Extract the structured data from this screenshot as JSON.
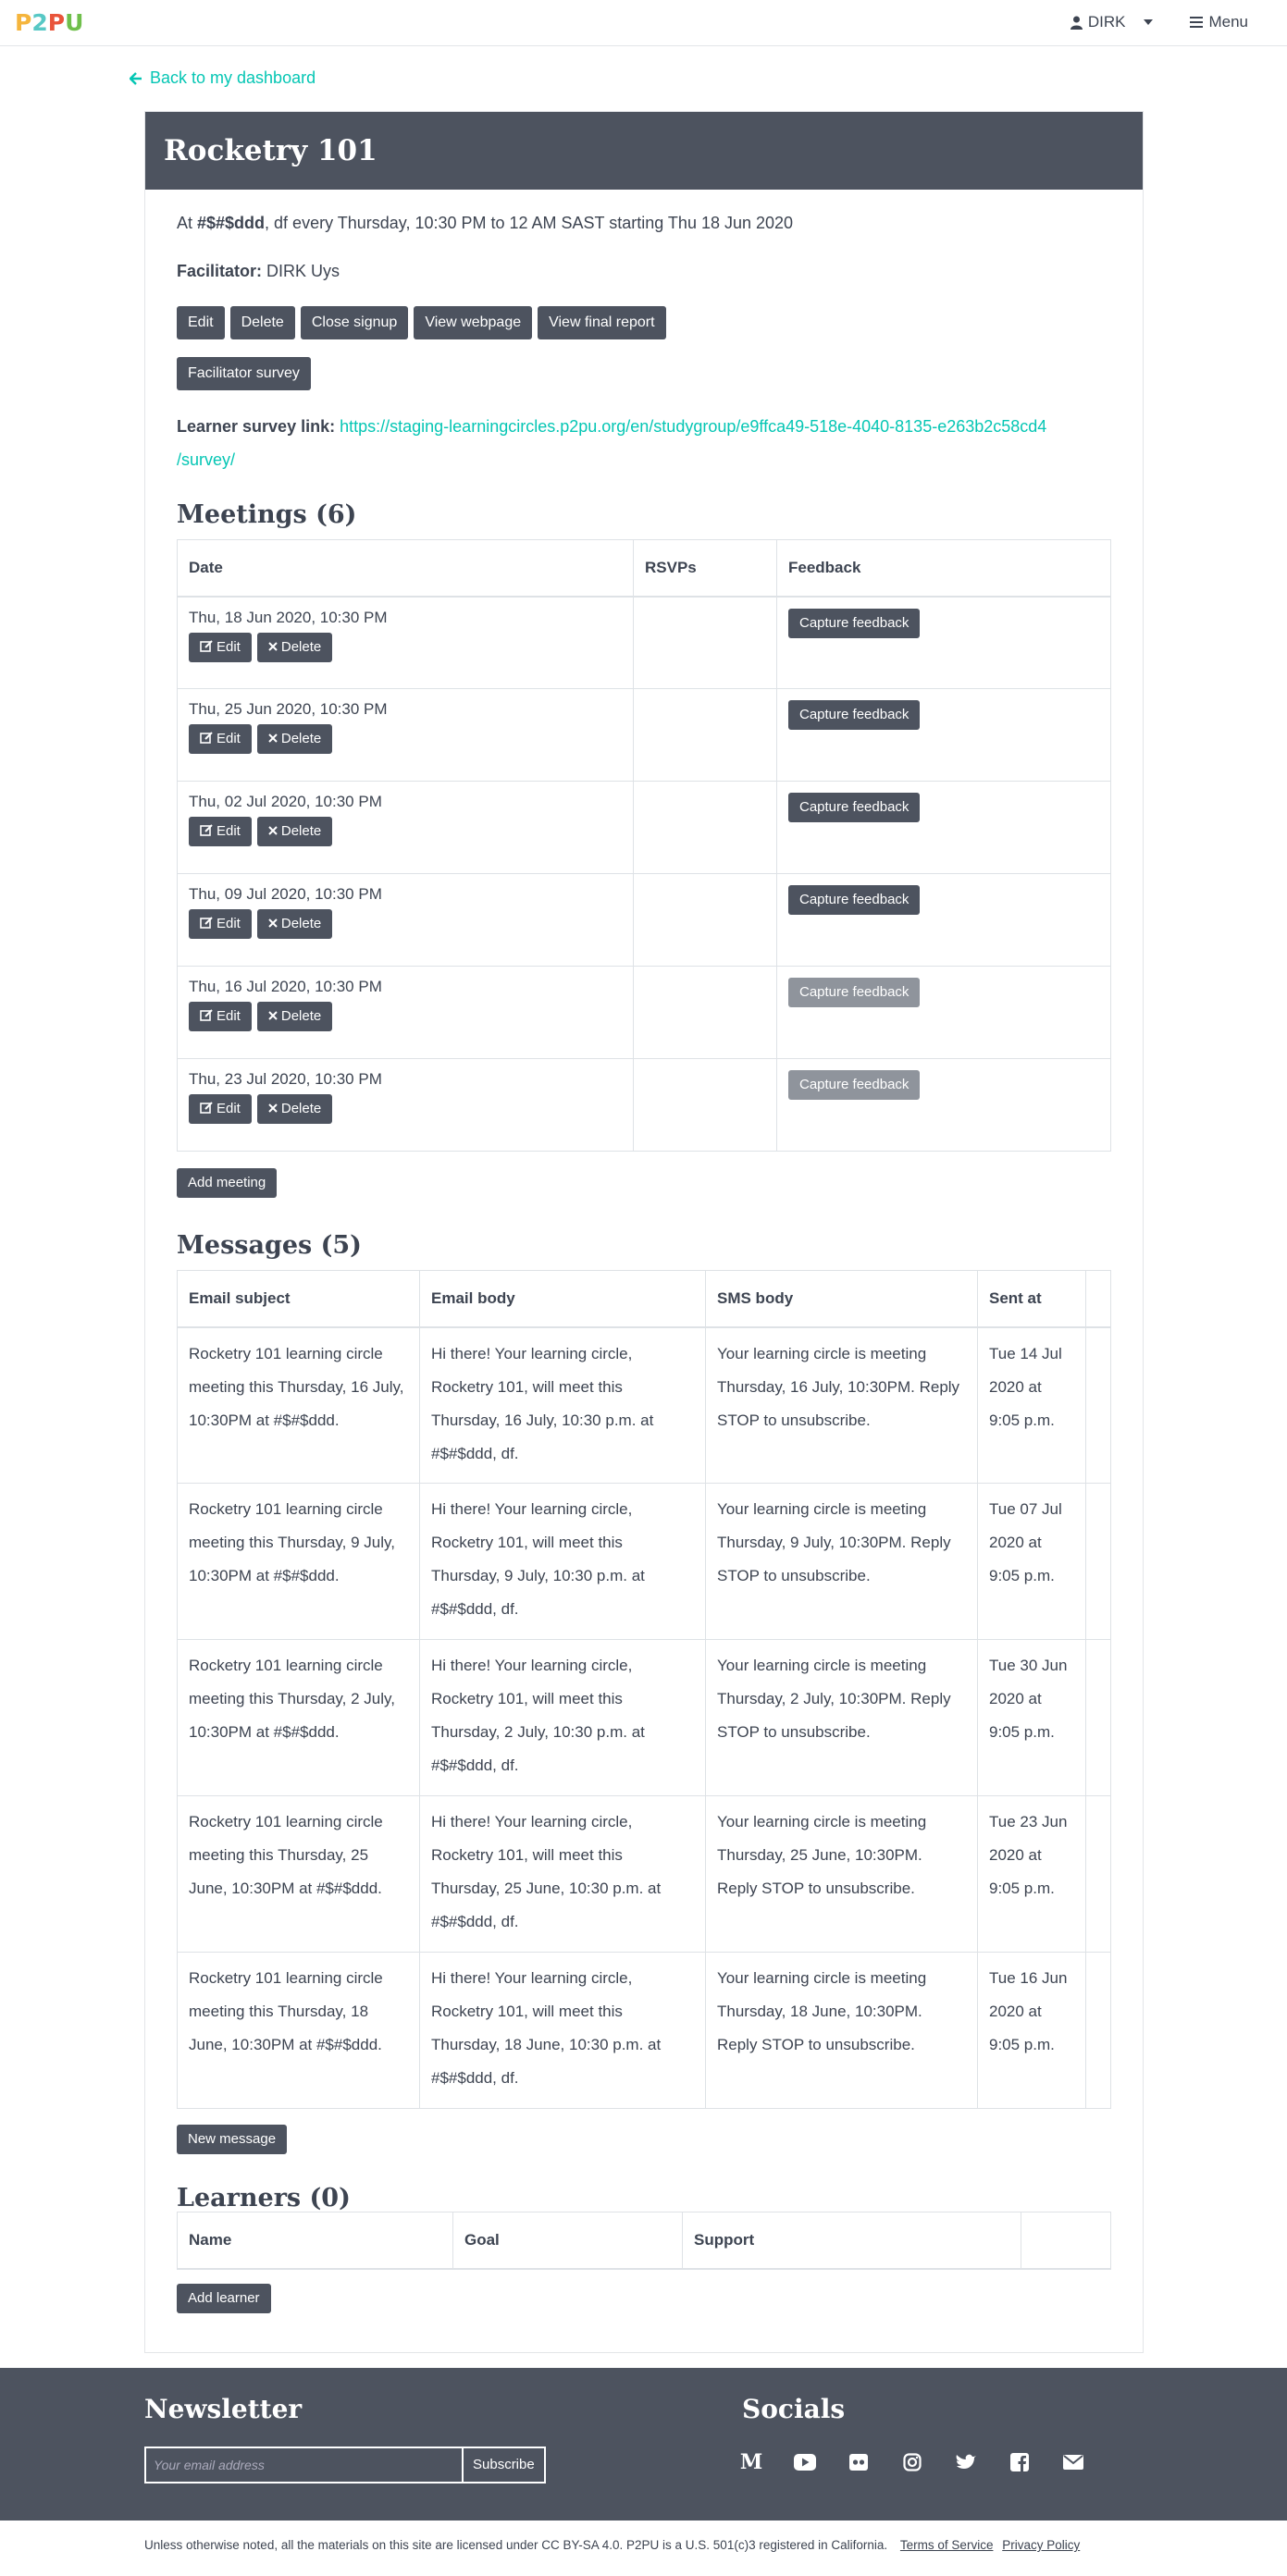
{
  "nav": {
    "logo": [
      "P",
      "2",
      "P",
      "U"
    ],
    "user": "DIRK",
    "menu": "Menu"
  },
  "back_link": "Back to my dashboard",
  "course": {
    "title": "Rocketry 101",
    "schedule_prefix": "At ",
    "venue": "#$#$ddd",
    "schedule_rest": ", df every Thursday, 10:30 PM to 12 AM SAST starting Thu 18 Jun 2020",
    "facilitator_label": "Facilitator:",
    "facilitator": " DIRK Uys"
  },
  "buttons": {
    "edit": "Edit",
    "delete": "Delete",
    "close_signup": "Close signup",
    "view_webpage": "View webpage",
    "view_final_report": "View final report",
    "facilitator_survey": "Facilitator survey"
  },
  "survey": {
    "label": "Learner survey link:",
    "url_line1": "https://staging-learningcircles.p2pu.org/en/studygroup/e9ffca49-518e-4040-8135-e263b2c58cd4",
    "url_line2": "/survey/"
  },
  "meetings": {
    "heading": "Meetings (6)",
    "columns": [
      "Date",
      "RSVPs",
      "Feedback"
    ],
    "edit_label": "Edit",
    "delete_label": "Delete",
    "feedback_label": "Capture feedback",
    "rows": [
      {
        "date": "Thu, 18 Jun 2020, 10:30 PM"
      },
      {
        "date": "Thu, 25 Jun 2020, 10:30 PM"
      },
      {
        "date": "Thu, 02 Jul 2020, 10:30 PM"
      },
      {
        "date": "Thu, 09 Jul 2020, 10:30 PM"
      },
      {
        "date": "Thu, 16 Jul 2020, 10:30 PM"
      },
      {
        "date": "Thu, 23 Jul 2020, 10:30 PM"
      }
    ],
    "add_label": "Add meeting"
  },
  "messages": {
    "heading": "Messages (5)",
    "columns": [
      "Email subject",
      "Email body",
      "SMS body",
      "Sent at"
    ],
    "rows": [
      {
        "subject": "Rocketry 101 learning circle meeting this Thursday, 16 July, 10:30PM at #$#$ddd.",
        "body": "Hi there! Your learning circle, Rocketry 101, will meet this Thursday, 16 July, 10:30 p.m. at #$#$ddd, df.",
        "sms": "Your learning circle is meeting Thursday, 16 July, 10:30PM. Reply STOP to unsubscribe.",
        "sent": "Tue 14 Jul 2020 at 9:05 p.m."
      },
      {
        "subject": "Rocketry 101 learning circle meeting this Thursday, 9 July, 10:30PM at #$#$ddd.",
        "body": "Hi there! Your learning circle, Rocketry 101, will meet this Thursday, 9 July, 10:30 p.m. at #$#$ddd, df.",
        "sms": "Your learning circle is meeting Thursday, 9 July, 10:30PM. Reply STOP to unsubscribe.",
        "sent": "Tue 07 Jul 2020 at 9:05 p.m."
      },
      {
        "subject": "Rocketry 101 learning circle meeting this Thursday, 2 July, 10:30PM at #$#$ddd.",
        "body": "Hi there! Your learning circle, Rocketry 101, will meet this Thursday, 2 July, 10:30 p.m. at #$#$ddd, df.",
        "sms": "Your learning circle is meeting Thursday, 2 July, 10:30PM. Reply STOP to unsubscribe.",
        "sent": "Tue 30 Jun 2020 at 9:05 p.m."
      },
      {
        "subject": "Rocketry 101 learning circle meeting this Thursday, 25 June, 10:30PM at #$#$ddd.",
        "body": "Hi there! Your learning circle, Rocketry 101, will meet this Thursday, 25 June, 10:30 p.m. at #$#$ddd, df.",
        "sms": "Your learning circle is meeting Thursday, 25 June, 10:30PM. Reply STOP to unsubscribe.",
        "sent": "Tue 23 Jun 2020 at 9:05 p.m."
      },
      {
        "subject": "Rocketry 101 learning circle meeting this Thursday, 18 June, 10:30PM at #$#$ddd.",
        "body": "Hi there! Your learning circle, Rocketry 101, will meet this Thursday, 18 June, 10:30 p.m. at #$#$ddd, df.",
        "sms": "Your learning circle is meeting Thursday, 18 June, 10:30PM. Reply STOP to unsubscribe.",
        "sent": "Tue 16 Jun 2020 at 9:05 p.m."
      }
    ],
    "new_label": "New message"
  },
  "learners": {
    "heading": "Learners (0)",
    "columns": [
      "Name",
      "Goal",
      "Support"
    ],
    "add_label": "Add learner"
  },
  "footer": {
    "newsletter": "Newsletter",
    "email_placeholder": "Your email address",
    "subscribe": "Subscribe",
    "socials": "Socials"
  },
  "legal": {
    "text": "Unless otherwise noted, all the materials on this site are licensed under CC BY-SA 4.0.  P2PU is a U.S. 501(c)3 registered in California.",
    "terms": "Terms of Service",
    "privacy": "Privacy Policy"
  },
  "colors": {
    "accent": "#05c6b4",
    "dark": "#4d535f"
  }
}
